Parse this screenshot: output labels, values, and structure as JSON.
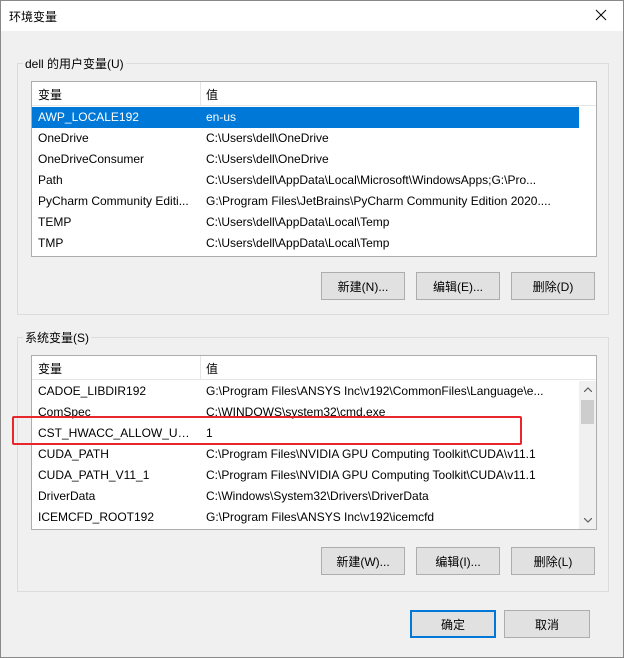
{
  "window": {
    "title": "环境变量",
    "close_label": "×"
  },
  "user_vars": {
    "group_label": "dell 的用户变量(U)",
    "col_variable": "变量",
    "col_value": "值",
    "rows": [
      {
        "name": "AWP_LOCALE192",
        "value": "en-us"
      },
      {
        "name": "OneDrive",
        "value": "C:\\Users\\dell\\OneDrive"
      },
      {
        "name": "OneDriveConsumer",
        "value": "C:\\Users\\dell\\OneDrive"
      },
      {
        "name": "Path",
        "value": "C:\\Users\\dell\\AppData\\Local\\Microsoft\\WindowsApps;G:\\Pro..."
      },
      {
        "name": "PyCharm Community Editi...",
        "value": "G:\\Program Files\\JetBrains\\PyCharm Community Edition 2020...."
      },
      {
        "name": "TEMP",
        "value": "C:\\Users\\dell\\AppData\\Local\\Temp"
      },
      {
        "name": "TMP",
        "value": "C:\\Users\\dell\\AppData\\Local\\Temp"
      }
    ],
    "new_label": "新建(N)...",
    "edit_label": "编辑(E)...",
    "delete_label": "删除(D)"
  },
  "system_vars": {
    "group_label": "系统变量(S)",
    "col_variable": "变量",
    "col_value": "值",
    "rows": [
      {
        "name": "CADOE_LIBDIR192",
        "value": "G:\\Program Files\\ANSYS Inc\\v192\\CommonFiles\\Language\\e..."
      },
      {
        "name": "ComSpec",
        "value": "C:\\WINDOWS\\system32\\cmd.exe"
      },
      {
        "name": "CST_HWACC_ALLOW_UNV...",
        "value": "1"
      },
      {
        "name": "CUDA_PATH",
        "value": "C:\\Program Files\\NVIDIA GPU Computing Toolkit\\CUDA\\v11.1"
      },
      {
        "name": "CUDA_PATH_V11_1",
        "value": "C:\\Program Files\\NVIDIA GPU Computing Toolkit\\CUDA\\v11.1"
      },
      {
        "name": "DriverData",
        "value": "C:\\Windows\\System32\\Drivers\\DriverData"
      },
      {
        "name": "ICEMCFD_ROOT192",
        "value": "G:\\Program Files\\ANSYS Inc\\v192\\icemcfd"
      }
    ],
    "new_label": "新建(W)...",
    "edit_label": "编辑(I)...",
    "delete_label": "删除(L)"
  },
  "footer": {
    "ok_label": "确定",
    "cancel_label": "取消"
  },
  "colors": {
    "selection": "#0078d7",
    "highlight": "#e8262c"
  }
}
